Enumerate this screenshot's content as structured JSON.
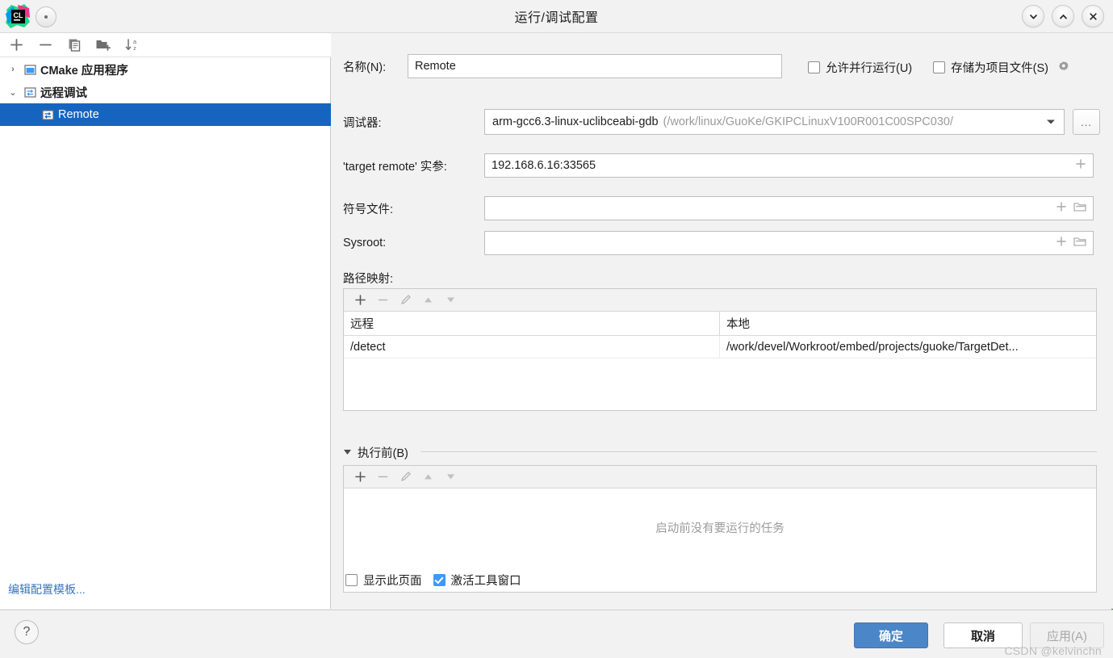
{
  "window": {
    "title": "运行/调试配置",
    "controls": {
      "minimize": "chevron-down",
      "maximize": "chevron-up",
      "close": "close"
    }
  },
  "sidebar": {
    "toolbar": [
      {
        "name": "add-icon",
        "glyph": "+"
      },
      {
        "name": "remove-icon",
        "glyph": "−"
      },
      {
        "name": "copy-icon",
        "glyph": "⧉"
      },
      {
        "name": "new-folder-icon",
        "glyph": "🗀"
      },
      {
        "name": "sort-alphabetically-icon",
        "glyph": "↓"
      }
    ],
    "tree": [
      {
        "label": "CMake 应用程序",
        "expanded": false,
        "arrow": "›",
        "level": 0,
        "selected": false
      },
      {
        "label": "远程调试",
        "expanded": true,
        "arrow": "⌄",
        "level": 0,
        "selected": false
      },
      {
        "label": "Remote",
        "arrow": "",
        "level": 1,
        "selected": true
      }
    ],
    "edit_template_link": "编辑配置模板..."
  },
  "form": {
    "name_label": "名称(N):",
    "name_value": "Remote",
    "allow_parallel_label": "允许并行运行(U)",
    "allow_parallel_checked": false,
    "store_as_project_label": "存储为项目文件(S)",
    "store_as_project_checked": false,
    "debugger_label": "调试器:",
    "debugger_value": "arm-gcc6.3-linux-uclibceabi-gdb",
    "debugger_path": "(/work/linux/GuoKe/GKIPCLinuxV100R001C00SPC030/",
    "ellipsis_button": "...",
    "target_remote_label": "'target remote' 实参:",
    "target_remote_value": "192.168.6.16:33565",
    "symbol_file_label": "符号文件:",
    "symbol_file_value": "",
    "sysroot_label": "Sysroot:",
    "sysroot_value": ""
  },
  "path_mapping": {
    "label": "路径映射:",
    "toolbar": [
      {
        "name": "add-icon",
        "glyph": "+",
        "enabled": true
      },
      {
        "name": "remove-icon",
        "glyph": "−",
        "enabled": false
      },
      {
        "name": "edit-icon",
        "glyph": "✎",
        "enabled": false
      },
      {
        "name": "move-up-icon",
        "glyph": "▲",
        "enabled": false
      },
      {
        "name": "move-down-icon",
        "glyph": "▼",
        "enabled": false
      }
    ],
    "columns": [
      "远程",
      "本地"
    ],
    "rows": [
      {
        "remote": "/detect",
        "local": "/work/devel/Workroot/embed/projects/guoke/TargetDet..."
      }
    ]
  },
  "before_launch": {
    "title": "执行前(B)",
    "toolbar": [
      {
        "name": "add-icon",
        "glyph": "+",
        "enabled": true
      },
      {
        "name": "remove-icon",
        "glyph": "−",
        "enabled": false
      },
      {
        "name": "edit-icon",
        "glyph": "✎",
        "enabled": false
      },
      {
        "name": "move-up-icon",
        "glyph": "▲",
        "enabled": false
      },
      {
        "name": "move-down-icon",
        "glyph": "▼",
        "enabled": false
      }
    ],
    "empty_message": "启动前没有要运行的任务",
    "show_page_label": "显示此页面",
    "show_page_checked": false,
    "activate_tool_window_label": "激活工具窗口",
    "activate_tool_window_checked": true
  },
  "footer": {
    "help": "?",
    "ok": "确定",
    "cancel": "取消",
    "apply": "应用(A)",
    "watermark": "CSDN @kelvinchn"
  },
  "colors": {
    "accent": "#4a86c8",
    "selection": "#1565c0",
    "checkbox": "#3b99fc",
    "link": "#3a76c0",
    "bg": "#f2f2f2"
  }
}
